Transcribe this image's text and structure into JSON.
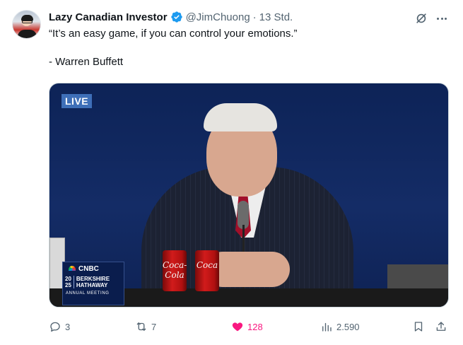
{
  "tweet": {
    "author_name": "Lazy Canadian Investor",
    "handle": "@JimChuong",
    "separator": "·",
    "time": "13 Std.",
    "text_line1": "“It’s an easy game, if you can control your emotions.”",
    "text_line2": "- Warren Buffett"
  },
  "media": {
    "live_badge": "LIVE",
    "cnbc_logo": "CNBC",
    "year_top": "20",
    "year_bottom": "25",
    "company_top": "BERKSHIRE",
    "company_bottom": "HATHAWAY",
    "event": "ANNUAL MEETING",
    "can_label": "Coca-Cola",
    "can_label2": "Coca"
  },
  "actions": {
    "replies": "3",
    "reposts": "7",
    "likes": "128",
    "views": "2.590"
  },
  "colors": {
    "verified": "#1d9bf0",
    "like": "#f91880",
    "secondary": "#536471"
  }
}
